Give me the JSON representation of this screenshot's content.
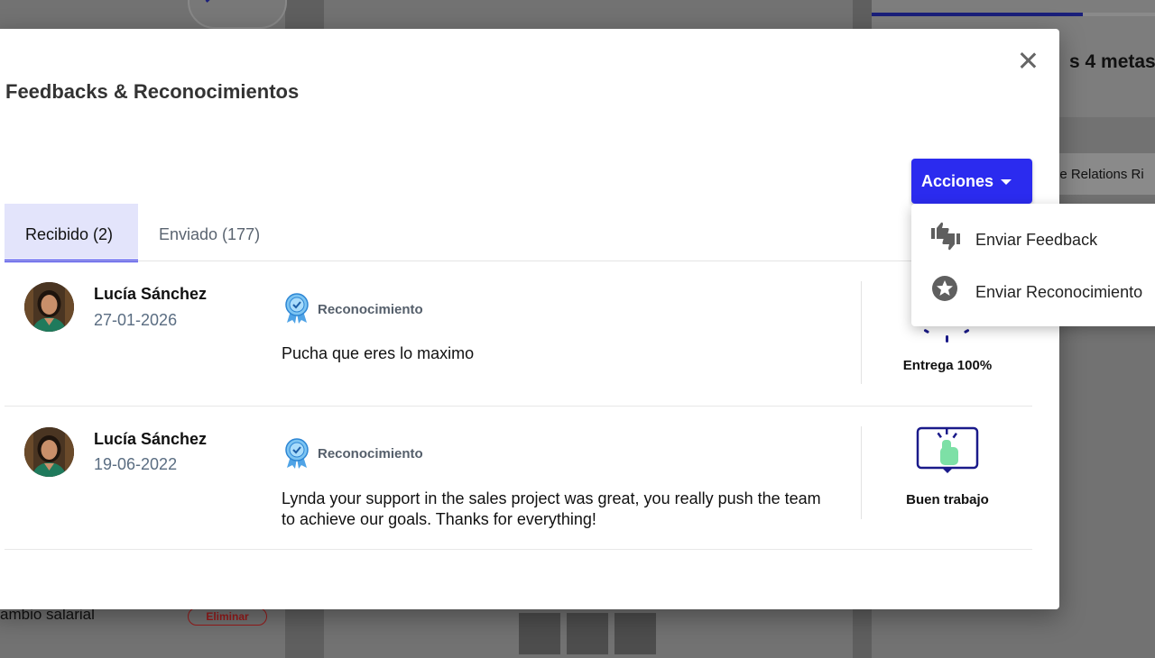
{
  "background": {
    "metas_text": "s 4 metas:",
    "relations_text": "ee Relations Ri",
    "cambio_text": "ambio salarial",
    "eliminar_label": "Eliminar"
  },
  "modal": {
    "title": "Feedbacks & Reconocimientos",
    "actions_button": "Acciones",
    "tabs": [
      {
        "label": "Recibido (2)",
        "active": true
      },
      {
        "label": "Enviado (177)",
        "active": false
      }
    ],
    "feedbacks": [
      {
        "sender": "Lucía Sánchez",
        "date": "27-01-2026",
        "type": "Reconocimiento",
        "message": "Pucha que eres lo maximo",
        "award": "Entrega 100%"
      },
      {
        "sender": "Lucía Sánchez",
        "date": "19-06-2022",
        "type": "Reconocimiento",
        "message": "Lynda your support in the sales project was great, you really push the team to achieve our goals. Thanks for everything!",
        "award": "Buen trabajo"
      }
    ]
  },
  "dropdown": {
    "items": [
      {
        "label": "Enviar Feedback",
        "icon": "thumbs-up-down-icon"
      },
      {
        "label": "Enviar Reconocimiento",
        "icon": "star-circle-icon"
      }
    ]
  },
  "colors": {
    "accent": "#2b2bef",
    "tab_active_bg": "#e3e4fb",
    "date_text": "#5a6d82",
    "badge_blue": "#4fa3e6"
  }
}
